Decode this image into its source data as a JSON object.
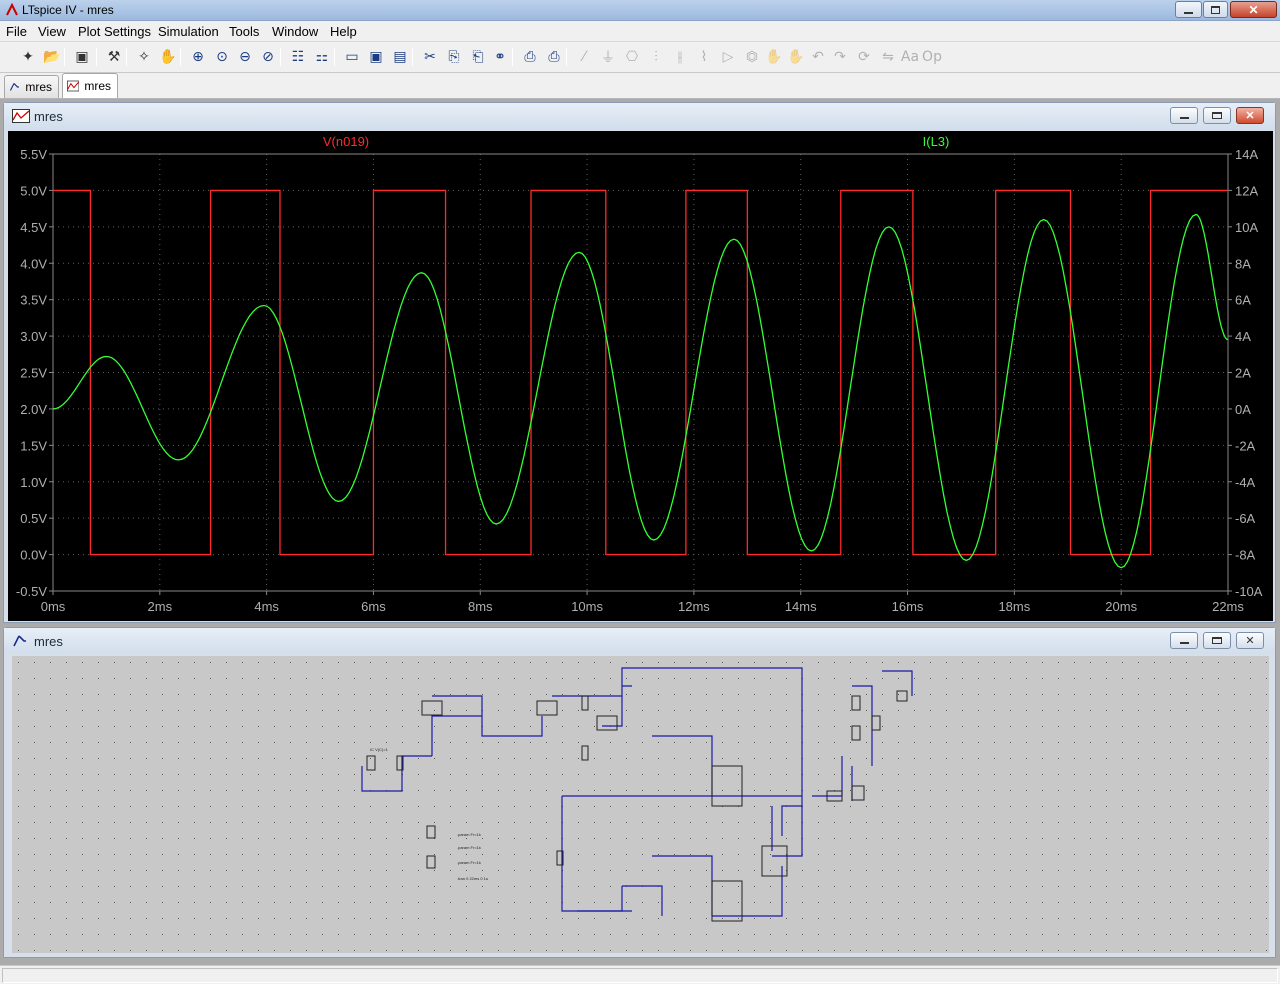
{
  "app": {
    "title": "LTspice IV - mres"
  },
  "menu": [
    "File",
    "View",
    "Plot Settings",
    "Simulation",
    "Tools",
    "Window",
    "Help"
  ],
  "toolbar": {
    "icons": [
      "new-schematic-icon",
      "open-icon",
      "save-icon",
      "control-panel-icon",
      "run-icon",
      "halt-icon",
      "zoom-in-icon",
      "zoom-pan-icon",
      "zoom-out-icon",
      "zoom-cancel-icon",
      "autorange-icon",
      "plot-settings-icon",
      "tile-horizontal-icon",
      "cascade-icon",
      "tile-vertical-icon",
      "cut-icon",
      "copy-icon",
      "paste-icon",
      "find-icon",
      "print-preview-icon",
      "print-icon",
      "wire-icon",
      "ground-icon",
      "label-icon",
      "resistor-icon",
      "capacitor-icon",
      "inductor-icon",
      "diode-icon",
      "component-icon",
      "move-icon",
      "drag-icon",
      "undo-icon",
      "redo-icon",
      "rotate-icon",
      "mirror-icon",
      "text-icon",
      "spice-directive-icon"
    ]
  },
  "tabs": [
    {
      "label": "mres",
      "icon": "schematic-icon"
    },
    {
      "label": "mres",
      "icon": "waveform-icon"
    }
  ],
  "plot_window": {
    "title": "mres",
    "background": "#000000",
    "trace_colors": {
      "V(n019)": "#ff2a2a",
      "I(L3)": "#33ff33"
    }
  },
  "schematic_window": {
    "title": "mres",
    "labels": {
      "ic": "IC V(C)=1",
      "directive1": ".tran 0 22ms 0 1u",
      ".params": ".param Fr=1k"
    }
  },
  "chart_data": {
    "type": "line",
    "title": "",
    "series": [
      {
        "name": "V(n019)",
        "axis": "left",
        "color": "#ff2a2a",
        "shape": "square",
        "high": 5.0,
        "low": 0.0,
        "transitions_ms": [
          0.0,
          0.7,
          2.95,
          4.25,
          6.0,
          7.35,
          8.95,
          10.35,
          11.85,
          13.0,
          14.75,
          16.1,
          17.65,
          19.05,
          20.55,
          22.0
        ],
        "start_level": "high"
      },
      {
        "name": "I(L3)",
        "axis": "right",
        "color": "#33ff33",
        "shape": "growing-sine",
        "peaks": [
          {
            "t": 1.0,
            "v": 2.72
          },
          {
            "t": 2.35,
            "v": 1.3
          },
          {
            "t": 3.95,
            "v": 3.42
          },
          {
            "t": 5.35,
            "v": 0.73
          },
          {
            "t": 6.9,
            "v": 3.87
          },
          {
            "t": 8.3,
            "v": 0.42
          },
          {
            "t": 9.85,
            "v": 4.15
          },
          {
            "t": 11.25,
            "v": 0.2
          },
          {
            "t": 12.75,
            "v": 4.33
          },
          {
            "t": 14.2,
            "v": 0.05
          },
          {
            "t": 15.65,
            "v": 4.5
          },
          {
            "t": 17.1,
            "v": -0.08
          },
          {
            "t": 18.55,
            "v": 4.6
          },
          {
            "t": 20.0,
            "v": -0.18
          },
          {
            "t": 21.4,
            "v": 4.67
          }
        ],
        "start": {
          "t": 0.0,
          "v": 2.0
        },
        "end": {
          "t": 22.0,
          "v": 2.95
        }
      }
    ],
    "x": {
      "range": [
        0,
        22
      ],
      "ticks": [
        "0ms",
        "2ms",
        "4ms",
        "6ms",
        "8ms",
        "10ms",
        "12ms",
        "14ms",
        "16ms",
        "18ms",
        "20ms",
        "22ms"
      ]
    },
    "y_left": {
      "range": [
        -0.5,
        5.5
      ],
      "ticks": [
        "5.5V",
        "5.0V",
        "4.5V",
        "4.0V",
        "3.5V",
        "3.0V",
        "2.5V",
        "2.0V",
        "1.5V",
        "1.0V",
        "0.5V",
        "0.0V",
        "-0.5V"
      ]
    },
    "y_right": {
      "range": [
        -10,
        14
      ],
      "ticks": [
        "14A",
        "12A",
        "10A",
        "8A",
        "6A",
        "4A",
        "2A",
        "0A",
        "-2A",
        "-4A",
        "-6A",
        "-8A",
        "-10A"
      ]
    },
    "grid": true
  }
}
